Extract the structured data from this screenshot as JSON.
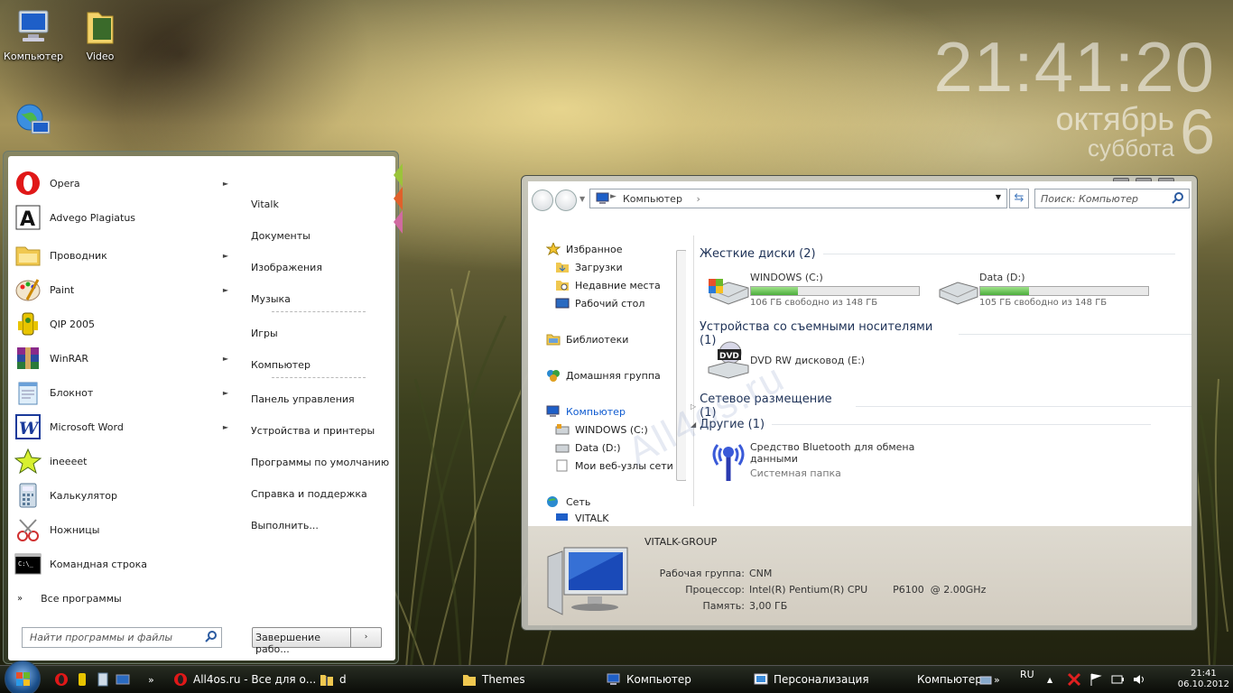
{
  "desktop": {
    "icons": [
      {
        "label": "Компьютер"
      },
      {
        "label": "Video"
      },
      {
        "label": ""
      }
    ]
  },
  "clock_widget": {
    "time": "21:41:20",
    "month": "октябрь",
    "weekday": "суббота",
    "day": "6"
  },
  "start_menu": {
    "programs": [
      {
        "label": "Opera",
        "arrow": true
      },
      {
        "label": "Advego Plagiatus",
        "arrow": false
      },
      {
        "label": "Проводник",
        "arrow": true
      },
      {
        "label": "Paint",
        "arrow": true
      },
      {
        "label": "QIP 2005",
        "arrow": false
      },
      {
        "label": "WinRAR",
        "arrow": true
      },
      {
        "label": "Блокнот",
        "arrow": true
      },
      {
        "label": "Microsoft Word",
        "arrow": true
      },
      {
        "label": "ineeeet",
        "arrow": false
      },
      {
        "label": "Калькулятор",
        "arrow": false
      },
      {
        "label": "Ножницы",
        "arrow": false
      },
      {
        "label": "Командная строка",
        "arrow": false
      }
    ],
    "all_programs": "Все программы",
    "all_programs_glyph": "»",
    "right_items": [
      "Vitalk",
      "Документы",
      "Изображения",
      "Музыка",
      "Игры",
      "Компьютер",
      "Панель управления",
      "Устройства и принтеры",
      "Программы по умолчанию",
      "Справка и поддержка",
      "Выполнить..."
    ],
    "search_placeholder": "Найти программы и файлы",
    "shutdown_label": "Завершение рабо...",
    "shutdown_arrow": "›",
    "tab_colors": [
      "#9bc43a",
      "#e0602a",
      "#d06aa0"
    ]
  },
  "explorer": {
    "address": "Компьютер",
    "address_arrow": "›",
    "search_placeholder": "Поиск: Компьютер",
    "nav": {
      "favorites": "Избранное",
      "downloads": "Загрузки",
      "recent": "Недавние места",
      "desktop": "Рабочий стол",
      "libraries": "Библиотеки",
      "homegroup": "Домашняя группа",
      "computer": "Компьютер",
      "drive_c": "WINDOWS (C:)",
      "drive_d": "Data (D:)",
      "web": "Мои веб-узлы сети M",
      "network": "Сеть",
      "network_pc": "VITALK"
    },
    "groups": {
      "hdd": "Жесткие диски (2)",
      "removable": "Устройства со съемными носителями (1)",
      "network": "Сетевое размещение (1)",
      "other": "Другие (1)"
    },
    "drives": [
      {
        "name": "WINDOWS (C:)",
        "free": "106 ГБ свободно из 148 ГБ",
        "used_fraction": 0.28
      },
      {
        "name": "Data (D:)",
        "free": "105 ГБ свободно из 148 ГБ",
        "used_fraction": 0.29
      }
    ],
    "dvd": "DVD RW дисковод (E:)",
    "dvd_badge": "DVD",
    "bluetooth": {
      "name": "Средство Bluetooth для обмена данными",
      "type": "Системная папка"
    },
    "details": {
      "name": "VITALK-GROUP",
      "workgroup_label": "Рабочая группа:",
      "workgroup": "CNM",
      "cpu_label": "Процессор:",
      "cpu": "Intel(R) Pentium(R) CPU        P6100  @ 2.00GHz",
      "ram_label": "Память:",
      "ram": "3,00 ГБ"
    },
    "watermark": "All4os.ru"
  },
  "taskbar": {
    "tasks": [
      {
        "label": "All4os.ru - Все для о..."
      },
      {
        "label": "d"
      },
      {
        "label": "Themes"
      },
      {
        "label": "Компьютер"
      },
      {
        "label": "Персонализация"
      }
    ],
    "toolbar_label": "Компьютер",
    "toolbar_chevron": "»",
    "lang": "RU",
    "time": "21:41",
    "date": "06.10.2012"
  },
  "colors": {
    "accent": "#1e3257",
    "link": "#0f5bd0",
    "bar_fill": "#4cae3c"
  }
}
